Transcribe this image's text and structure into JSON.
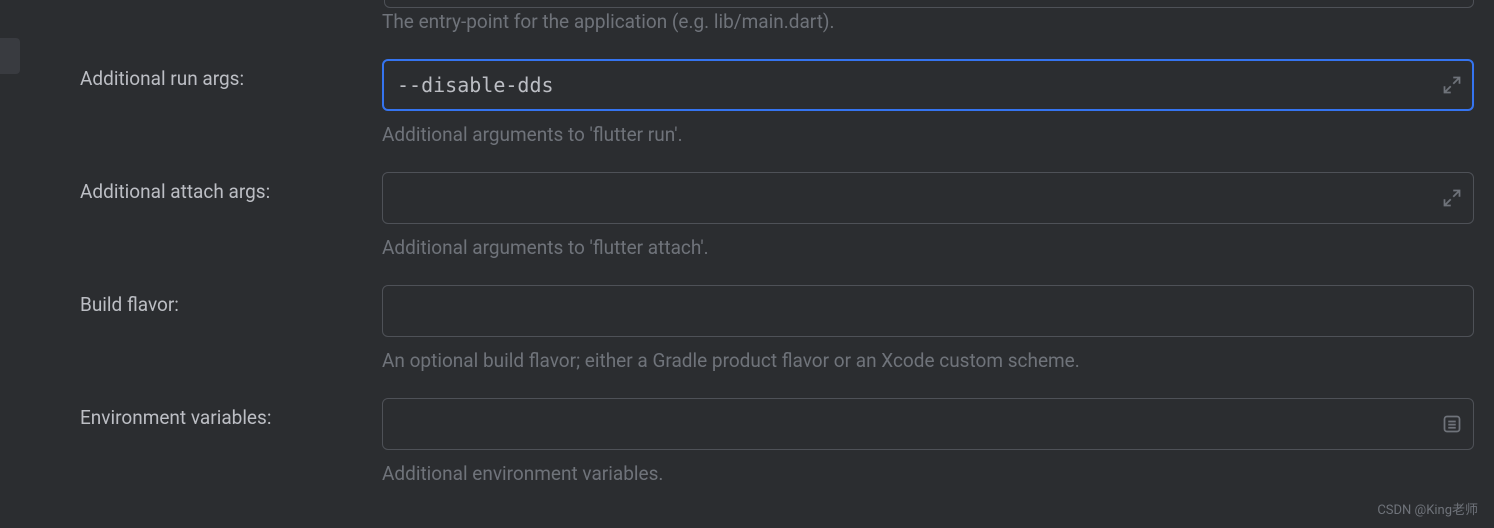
{
  "top_hint": "The entry-point for the application (e.g. lib/main.dart).",
  "fields": {
    "additional_run_args": {
      "label": "Additional run args:",
      "value": "--disable-dds",
      "hint": "Additional arguments to 'flutter run'."
    },
    "additional_attach_args": {
      "label": "Additional attach args:",
      "value": "",
      "hint": "Additional arguments to 'flutter attach'."
    },
    "build_flavor": {
      "label": "Build flavor:",
      "value": "",
      "hint": "An optional build flavor; either a Gradle product flavor or an Xcode custom scheme."
    },
    "environment_variables": {
      "label": "Environment variables:",
      "value": "",
      "hint": "Additional environment variables."
    }
  },
  "watermark": "CSDN @King老师"
}
